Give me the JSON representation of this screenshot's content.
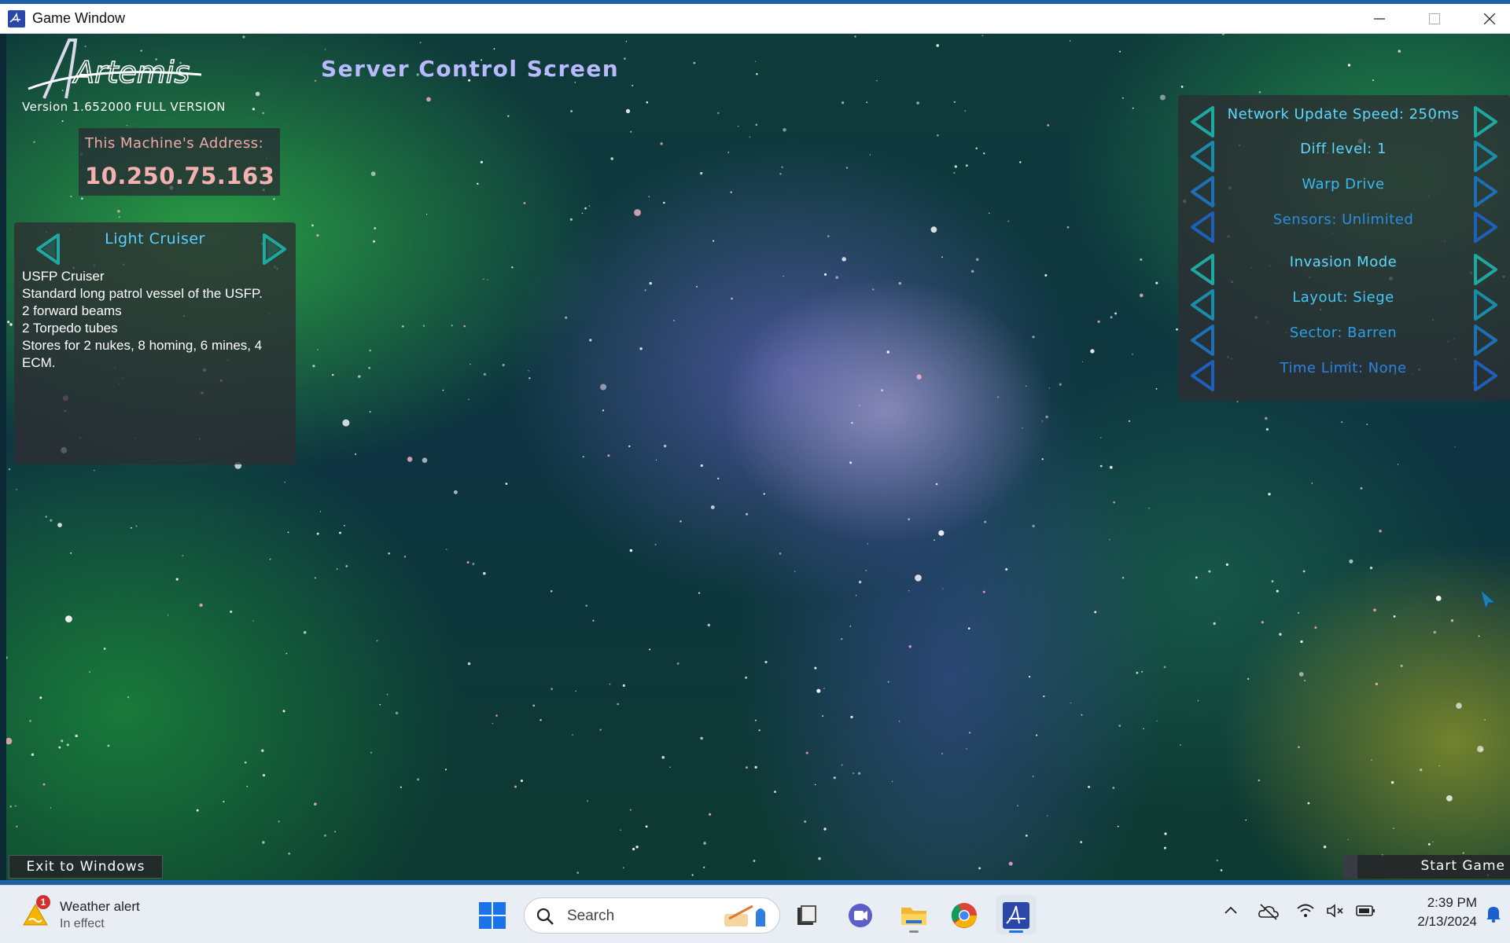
{
  "window": {
    "title": "Game Window"
  },
  "game": {
    "version": "Version 1.652000 FULL VERSION",
    "logo_text": "Artemis",
    "screen_title": "Server Control Screen",
    "address": {
      "label": "This Machine's Address:",
      "value": "10.250.75.163"
    },
    "ship": {
      "name": "Light Cruiser",
      "description": [
        "USFP Cruiser",
        "Standard long patrol vessel of the USFP.",
        "2 forward beams",
        "2 Torpedo tubes",
        "Stores for 2 nukes, 8 homing, 6 mines, 4 ECM."
      ]
    },
    "settings": [
      {
        "label": "Network Update Speed: 250ms"
      },
      {
        "label": "Diff level: 1"
      },
      {
        "label": "Warp Drive"
      },
      {
        "label": "Sensors: Unlimited"
      },
      {
        "label": "Invasion Mode"
      },
      {
        "label": "Layout: Siege"
      },
      {
        "label": "Sector: Barren"
      },
      {
        "label": "Time Limit: None"
      }
    ],
    "buttons": {
      "exit": "Exit to Windows",
      "start": "Start Game"
    }
  },
  "taskbar": {
    "weather": {
      "title": "Weather alert",
      "subtitle": "In effect",
      "badge": "1"
    },
    "search_placeholder": "Search",
    "apps": [
      "start-icon",
      "search-icon",
      "task-view-icon",
      "teams-chat-icon",
      "file-explorer-icon",
      "chrome-icon",
      "artemis-app-icon"
    ],
    "tray": [
      "chevron-up-icon",
      "onedrive-icon",
      "wifi-icon",
      "volume-muted-icon",
      "battery-icon",
      "notification-bell-icon"
    ],
    "clock": {
      "time": "2:39 PM",
      "date": "2/13/2024"
    }
  },
  "colors": {
    "title_accent": "#b9b9ff",
    "address_text": "#f3b1b1",
    "setting_text": "#3ab8f0",
    "arrow_teal": "#1fa8a0",
    "arrow_blue": "#1e5fb8"
  }
}
